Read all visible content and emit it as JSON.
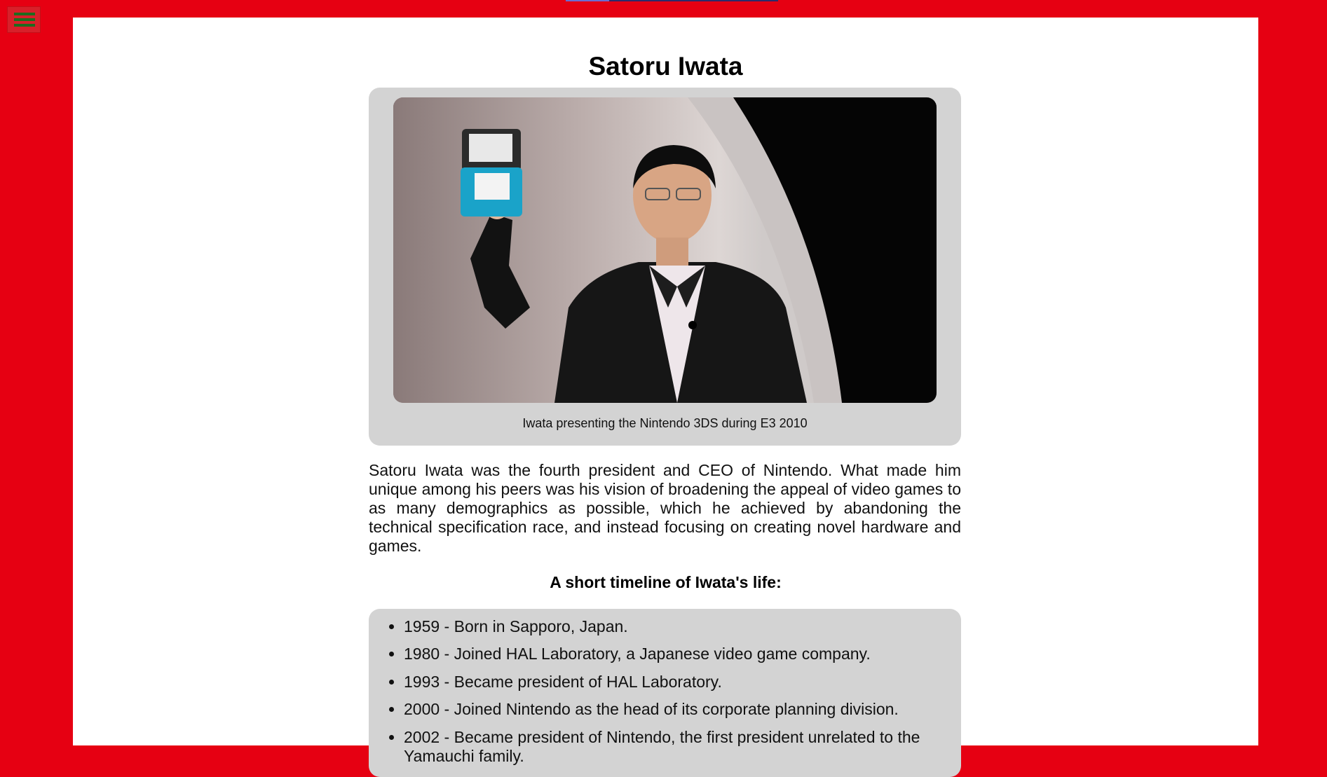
{
  "menu": {
    "icon": "hamburger-menu-icon"
  },
  "colors": {
    "background": "#e60012",
    "panel": "#d3d3d3",
    "menu_bars": "#1f6b1f"
  },
  "page": {
    "title": "Satoru Iwata",
    "photo_icon": "person-holding-handheld-console-photo",
    "caption": "Iwata presenting the Nintendo 3DS during E3 2010",
    "intro": "Satoru Iwata was the fourth president and CEO of Nintendo. What made him unique among his peers was his vision of broadening the appeal of video games to as many demographics as possible, which he achieved by abandoning the technical specification race, and instead focusing on creating novel hardware and games.",
    "timeline_heading": "A short timeline of Iwata's life:",
    "timeline": [
      "1959 - Born in Sapporo, Japan.",
      "1980 - Joined HAL Laboratory, a Japanese video game company.",
      "1993 - Became president of HAL Laboratory.",
      "2000 - Joined Nintendo as the head of its corporate planning division.",
      "2002 - Became president of Nintendo, the first president unrelated to the Yamauchi family."
    ]
  }
}
